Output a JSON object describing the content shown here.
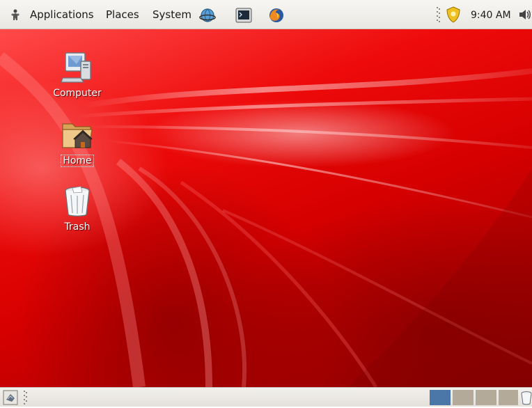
{
  "top_panel": {
    "menus": [
      "Applications",
      "Places",
      "System"
    ],
    "launchers": [
      "network-globe-icon",
      "terminal-icon",
      "firefox-icon"
    ],
    "tray": [
      "security-badge-icon",
      "volume-icon"
    ],
    "clock": "9:40 AM"
  },
  "desktop": {
    "icons": [
      {
        "label": "Computer",
        "icon": "computer-icon"
      },
      {
        "label": "Home",
        "icon": "home-folder-icon",
        "selected": true
      },
      {
        "label": "Trash",
        "icon": "trash-icon"
      }
    ]
  },
  "bottom_panel": {
    "show_desktop_icon": "show-desktop-icon",
    "workspaces": [
      {
        "active": true,
        "color": "#4a76a8"
      },
      {
        "active": false,
        "color": "#b3aa99"
      },
      {
        "active": false,
        "color": "#b3aa99"
      },
      {
        "active": false,
        "color": "#b3aa99"
      }
    ],
    "trash_applet_icon": "trash-applet-icon"
  },
  "colors": {
    "wallpaper_primary": "#e00000",
    "panel_bg": "#edebe6",
    "active_workspace": "#4a76a8"
  }
}
